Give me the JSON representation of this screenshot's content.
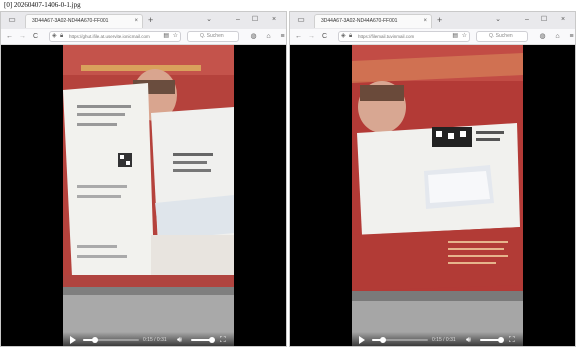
{
  "caption": "[0] 20260407-1406-0-1.jpg",
  "windows": [
    {
      "tab": {
        "title": "3D44A67-3A02-ND44A670-FF001",
        "close": "×"
      },
      "new_tab": "+",
      "controls": {
        "chevron": "⌄",
        "minimize": "–",
        "maximize": "☐",
        "close": "×"
      },
      "nav": {
        "back": "←",
        "forward": "→",
        "reload": "C"
      },
      "url": "https://ghut.ifile.at.uservite.ionicmail.com",
      "search_placeholder": "Q. Suchen",
      "video": {
        "time": "0:15 / 0:31",
        "progress": 0.22,
        "volume": 1.0
      }
    },
    {
      "tab": {
        "title": "3D44A67-3A02-ND44A670-FF001",
        "close": "×"
      },
      "new_tab": "+",
      "controls": {
        "chevron": "⌄",
        "minimize": "–",
        "maximize": "☐",
        "close": "×"
      },
      "nav": {
        "back": "←",
        "forward": "→",
        "reload": "C"
      },
      "url": "https://filemail.tuvinmail.com",
      "search_placeholder": "Q. Suchen",
      "video": {
        "time": "0:15 / 0:31",
        "progress": 0.2,
        "volume": 1.0
      }
    }
  ]
}
